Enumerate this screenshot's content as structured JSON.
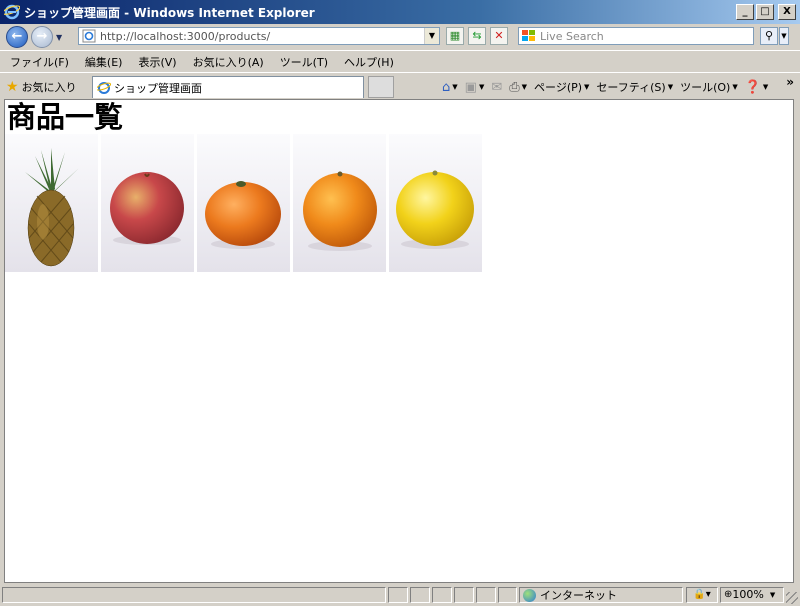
{
  "window": {
    "title": "ショップ管理画面 - Windows Internet Explorer",
    "minimize": "_",
    "maximize": "□",
    "close": "X"
  },
  "nav": {
    "back": "←",
    "forward": "→",
    "url": "http://localhost:3000/products/",
    "search_placeholder": "Live Search"
  },
  "menu": {
    "items": [
      "ファイル(F)",
      "編集(E)",
      "表示(V)",
      "お気に入り(A)",
      "ツール(T)",
      "ヘルプ(H)"
    ]
  },
  "favorites": {
    "label": "お気に入り",
    "tab_title": "ショップ管理画面"
  },
  "commands": {
    "page": "ページ(P)",
    "safety": "セーフティ(S)",
    "tools": "ツール(O)",
    "more": "»"
  },
  "page": {
    "heading": "商品一覧",
    "products": [
      {
        "name": "pineapple",
        "color": "#c98a2a"
      },
      {
        "name": "apple",
        "color": "#c8484a"
      },
      {
        "name": "tangerine",
        "color": "#ec7a1e"
      },
      {
        "name": "orange",
        "color": "#f08a1a"
      },
      {
        "name": "grapefruit",
        "color": "#f2d21a"
      }
    ]
  },
  "status": {
    "zone": "インターネット",
    "zoom": "100%"
  }
}
